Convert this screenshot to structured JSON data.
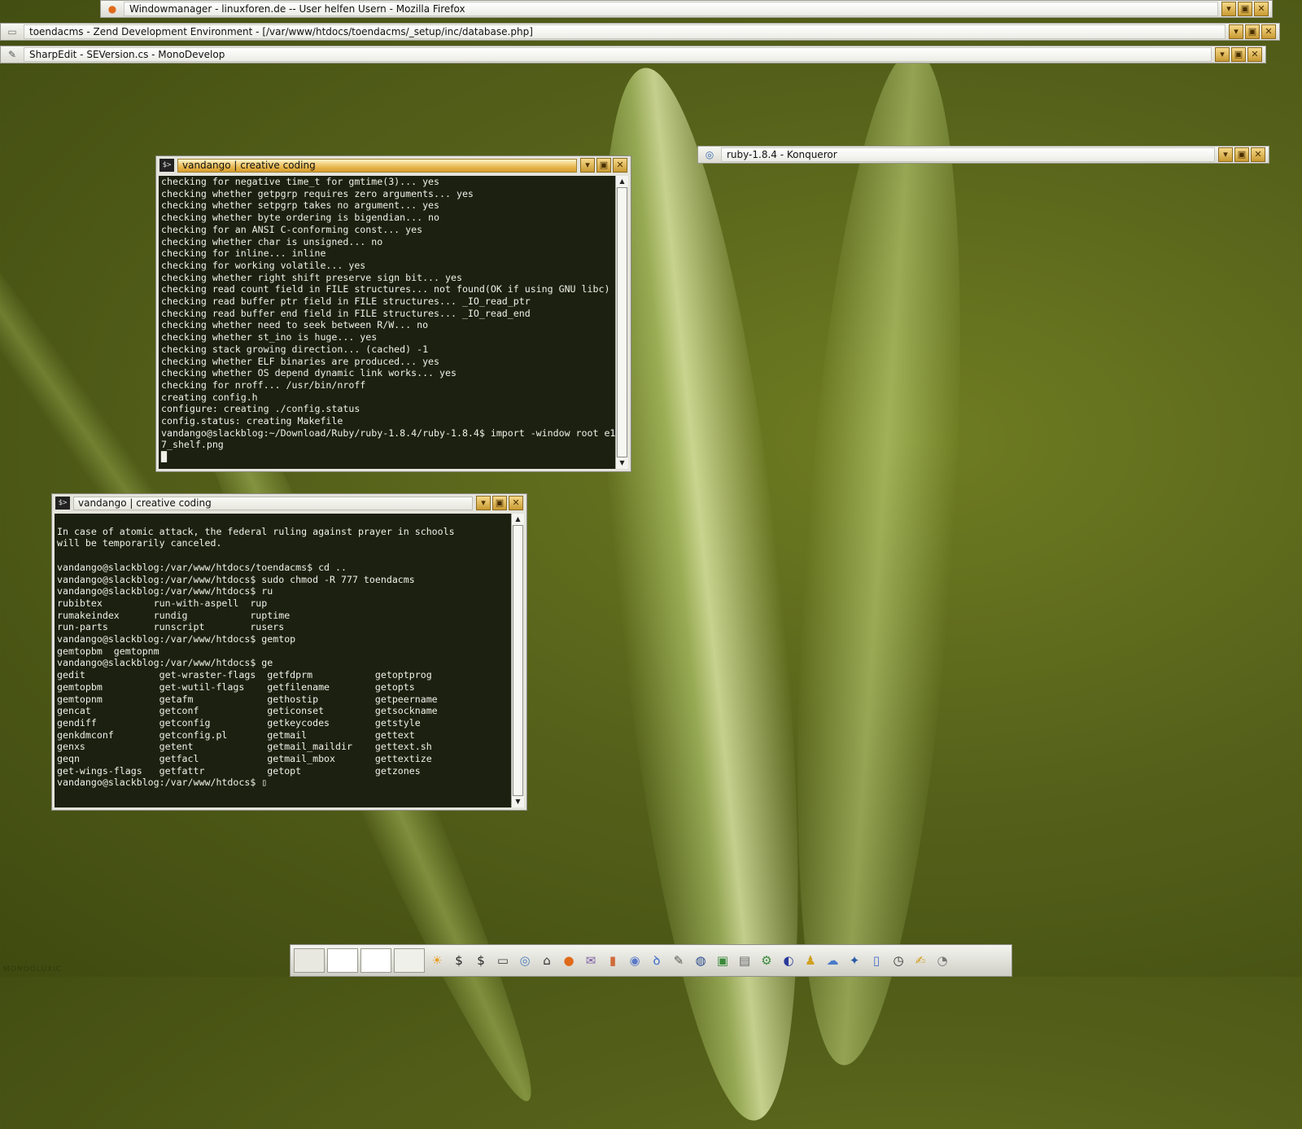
{
  "windows": {
    "firefox": {
      "title": "Windowmanager - linuxforen.de -- User helfen Usern - Mozilla Firefox"
    },
    "zend": {
      "title": "toendacms - Zend Development Environment - [/var/www/htdocs/toendacms/_setup/inc/database.php]"
    },
    "monodevelop": {
      "title": "SharpEdit - SEVersion.cs - MonoDevelop"
    },
    "konqueror": {
      "title": "ruby-1.8.4 - Konqueror"
    }
  },
  "window_buttons": {
    "shade": "▾",
    "maximize": "▣",
    "close": "✕"
  },
  "terminal1": {
    "title": "vandango | creative coding",
    "output": "checking for negative time_t for gmtime(3)... yes\nchecking whether getpgrp requires zero arguments... yes\nchecking whether setpgrp takes no argument... yes\nchecking whether byte ordering is bigendian... no\nchecking for an ANSI C-conforming const... yes\nchecking whether char is unsigned... no\nchecking for inline... inline\nchecking for working volatile... yes\nchecking whether right shift preserve sign bit... yes\nchecking read count field in FILE structures... not found(OK if using GNU libc)\nchecking read buffer ptr field in FILE structures... _IO_read_ptr\nchecking read buffer end field in FILE structures... _IO_read_end\nchecking whether need to seek between R/W... no\nchecking whether st_ino is huge... yes\nchecking stack growing direction... (cached) -1\nchecking whether ELF binaries are produced... yes\nchecking whether OS depend dynamic link works... yes\nchecking for nroff... /usr/bin/nroff\ncreating config.h\nconfigure: creating ./config.status\nconfig.status: creating Makefile\nvandango@slackblog:~/Download/Ruby/ruby-1.8.4/ruby-1.8.4$ import -window root e1\n7_shelf.png\n█"
  },
  "terminal2": {
    "title": "vandango | creative coding",
    "output": "\nIn case of atomic attack, the federal ruling against prayer in schools\nwill be temporarily canceled.\n\nvandango@slackblog:/var/www/htdocs/toendacms$ cd ..\nvandango@slackblog:/var/www/htdocs$ sudo chmod -R 777 toendacms\nvandango@slackblog:/var/www/htdocs$ ru\nrubibtex         run-with-aspell  rup\nrumakeindex      rundig           ruptime\nrun-parts        runscript        rusers\nvandango@slackblog:/var/www/htdocs$ gemtop\ngemtopbm  gemtopnm\nvandango@slackblog:/var/www/htdocs$ ge\ngedit             get-wraster-flags  getfdprm           getoptprog\ngemtopbm          get-wutil-flags    getfilename        getopts\ngemtopnm          getafm             gethostip          getpeername\ngencat            getconf            geticonset         getsockname\ngendiff           getconfig          getkeycodes        getstyle\ngenkdmconf        getconfig.pl       getmail            gettext\ngenxs             getent             getmail_maildir    gettext.sh\ngeqn              getfacl            getmail_mbox       gettextize\nget-wings-flags   getfattr           getopt             getzones\nvandango@slackblog:/var/www/htdocs$ ▯"
  },
  "dock": {
    "launchers": [
      {
        "icon": "sun-icon",
        "glyph": "☀",
        "color": "#e8a020"
      },
      {
        "icon": "terminal-icon",
        "glyph": "$",
        "color": "#222222"
      },
      {
        "icon": "terminal-icon-2",
        "glyph": "$",
        "color": "#222222"
      },
      {
        "icon": "window-icon",
        "glyph": "▭",
        "color": "#444444"
      },
      {
        "icon": "network-icon",
        "glyph": "◎",
        "color": "#4a7ab8"
      },
      {
        "icon": "home-icon",
        "glyph": "⌂",
        "color": "#333333"
      },
      {
        "icon": "firefox-icon",
        "glyph": "●",
        "color": "#e06a1a"
      },
      {
        "icon": "mail-icon",
        "glyph": "✉",
        "color": "#7a5aa0"
      },
      {
        "icon": "bookmark-icon",
        "glyph": "▮",
        "color": "#d06a3a"
      },
      {
        "icon": "gimp-icon",
        "glyph": "◉",
        "color": "#5a7ac8"
      },
      {
        "icon": "bluefish-icon",
        "glyph": "ꝺ",
        "color": "#3a6ac8"
      },
      {
        "icon": "pencil-icon",
        "glyph": "✎",
        "color": "#555555"
      },
      {
        "icon": "globe-icon",
        "glyph": "◍",
        "color": "#2a4a8a"
      },
      {
        "icon": "image-viewer-icon",
        "glyph": "▣",
        "color": "#3a8a3a"
      },
      {
        "icon": "document-icon",
        "glyph": "▤",
        "color": "#666666"
      },
      {
        "icon": "gear-icon",
        "glyph": "⚙",
        "color": "#3a8a3a"
      },
      {
        "icon": "sphere-icon",
        "glyph": "◐",
        "color": "#2a3a9a"
      },
      {
        "icon": "user-icon",
        "glyph": "♟",
        "color": "#d0a020"
      },
      {
        "icon": "chat-icon",
        "glyph": "☁",
        "color": "#4a7ac8"
      },
      {
        "icon": "paint-icon",
        "glyph": "✦",
        "color": "#2a5aa8"
      },
      {
        "icon": "notes-icon",
        "glyph": "▯",
        "color": "#4a6ac8"
      },
      {
        "icon": "clock-icon",
        "glyph": "◷",
        "color": "#333333"
      },
      {
        "icon": "editor-icon",
        "glyph": "✍",
        "color": "#d0a020"
      },
      {
        "icon": "logout-icon",
        "glyph": "◔",
        "color": "#777777"
      }
    ]
  },
  "watermark": "MONOOLUXIC"
}
